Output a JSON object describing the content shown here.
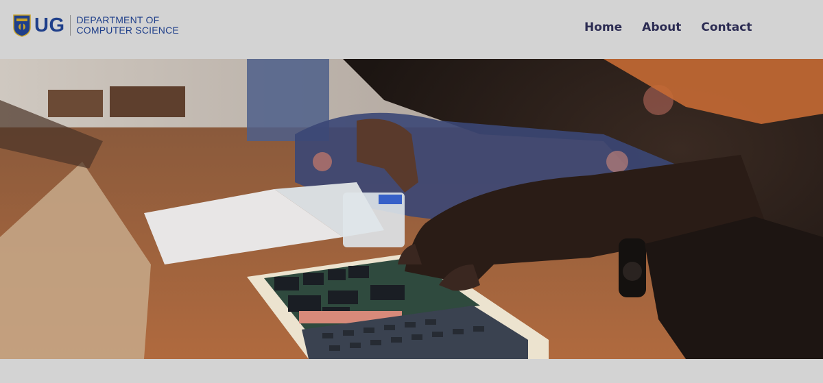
{
  "header": {
    "logo": {
      "abbr": "UG",
      "line1": "DEPARTMENT OF",
      "line2": "COMPUTER SCIENCE"
    },
    "nav": [
      {
        "label": "Home"
      },
      {
        "label": "About"
      },
      {
        "label": "Contact"
      }
    ]
  },
  "colors": {
    "header_bg": "#d3d3d3",
    "brand_blue": "#1f3f8a",
    "nav_text": "#2b2b52"
  },
  "hero": {
    "image": "students-working-on-microprocessor-trainer-board-photo"
  }
}
